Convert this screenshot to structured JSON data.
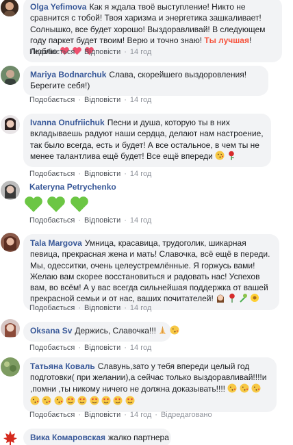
{
  "comments": [
    {
      "author": "Olga Yefimova",
      "text_before": "Как я ждала твоё выступление! Никто не сравнится с тобой! Твоя харизма и энергетика зашкаливает! Солнышко, все будет хорошо! Выздоравливай! В следующем году паркет будет твоим! Верю и точно знаю!",
      "highlight": "Ты лучшая",
      "text_after": "! Люблю",
      "like": "Подобається",
      "reply": "Відповісти",
      "time": "14 год"
    },
    {
      "author": "Mariya Bodnarchuk",
      "text": "Слава, скорейшего выздоровления! Берегите себя!)",
      "like": "Подобається",
      "reply": "Відповісти",
      "time": "14 год"
    },
    {
      "author": "Ivanna Onufriichuk",
      "text": "Песни и душа, которую ты в них вкладываешь радуют наши сердца, делают нам настроение, так было всегда, есть и будет! А все остальное, в чем ты не менее талантлива ещё будет! Все ещё впереди",
      "like": "Подобається",
      "reply": "Відповісти",
      "time": "14 год"
    },
    {
      "author": "Kateryna Petrychenko",
      "like": "Подобається",
      "reply": "Відповісти",
      "time": "14 год"
    },
    {
      "author": "Tala Margova",
      "text": "Умница, красавица, трудоголик, шикарная певица, прекрасная жена и мать! Славочка, всё ещё в переди. Мы, одесситки, очень целеустремлённые. Я горжусь вами! Желаю вам скорее восстановиться и радовать нас! Успехов вам, во всём! А у вас всегда сильнейшая поддержка от вашей прекрасной семьи и от нас, ваших почитателей!",
      "like": "Подобається",
      "reply": "Відповісти",
      "time": "14 год"
    },
    {
      "author": "Oksana Sv",
      "text": "Держись, Славочка!!!",
      "like": "Подобається",
      "reply": "Відповісти",
      "time": "14 год"
    },
    {
      "author": "Татьяна Коваль",
      "text": "Славунь,зато у тебя впереди целый год подготовки( при желании),а сейчас только выздоравливай!!!!и ,помни ,ты никому ничего не должна доказывать!!!!",
      "like": "Подобається",
      "reply": "Відповісти",
      "time": "14 год",
      "edited": "Відредаговано"
    },
    {
      "author": "Вика Комаровская",
      "text": "жалко партнера"
    }
  ],
  "colors": {
    "link_blue": "#385898",
    "bubble_bg": "#f2f3f5",
    "meta_gray": "#90949c",
    "highlight": "#f5533d",
    "heart_red": "#f0506e",
    "green_heart": "#6cc644"
  },
  "icons": [
    "red-heart-icon",
    "kissing-face-icon",
    "rose-icon",
    "green-heart-icon",
    "praying-hands-icon",
    "heart-eyes-icon",
    "sunflower-icon",
    "bouquet-icon",
    "woman-face-icon",
    "maple-leaf-avatar"
  ]
}
